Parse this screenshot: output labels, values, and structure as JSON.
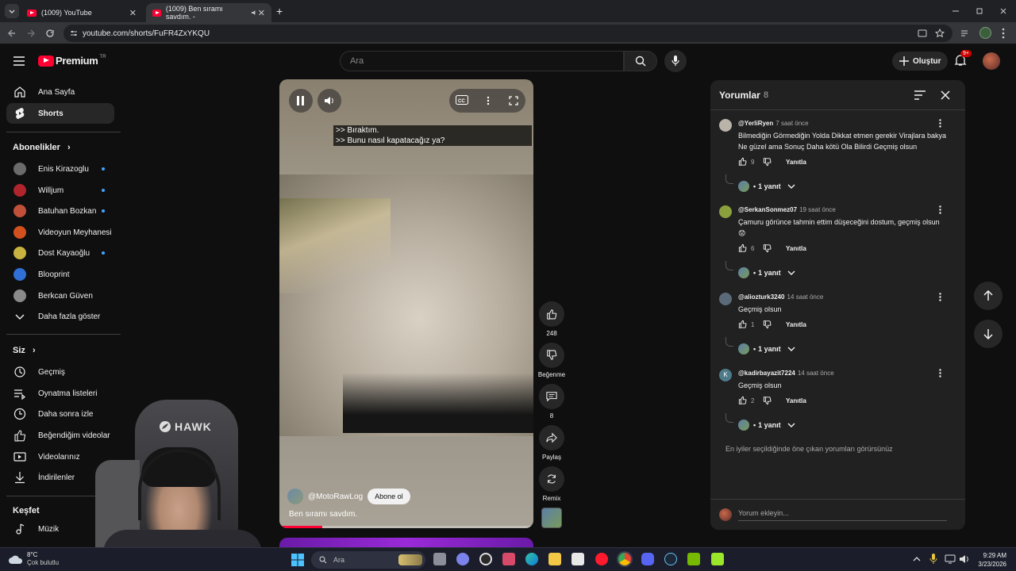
{
  "browser": {
    "tabs": [
      {
        "title": "(1009) YouTube",
        "close": "✕"
      },
      {
        "title": "(1009) Ben sıramı savdım. -",
        "close": "✕"
      }
    ],
    "new_tab": "+",
    "url": "youtube.com/shorts/FuFR4ZxYKQU"
  },
  "header": {
    "logo_text": "Premium",
    "logo_region": "TR",
    "search_placeholder": "Ara",
    "create_label": "Oluştur",
    "notif_count": "9+"
  },
  "sidebar": {
    "main": [
      {
        "label": "Ana Sayfa",
        "icon": "home-icon"
      },
      {
        "label": "Shorts",
        "icon": "shorts-icon",
        "active": true
      }
    ],
    "subs_title": "Abonelikler",
    "subs": [
      {
        "label": "Enis Kirazoglu",
        "color": "#6b6b6b",
        "dot": true
      },
      {
        "label": "Willjum",
        "color": "#b0242c",
        "dot": true
      },
      {
        "label": "Batuhan Bozkan",
        "color": "#c0503a",
        "dot": true
      },
      {
        "label": "Videoyun Meyhanesi",
        "color": "#d2501e",
        "dot": false
      },
      {
        "label": "Dost Kayaoğlu",
        "color": "#c9b340",
        "dot": true
      },
      {
        "label": "Blooprint",
        "color": "#2f6fd6",
        "dot": false
      },
      {
        "label": "Berkcan Güven",
        "color": "#8a8a8a",
        "dot": false
      }
    ],
    "show_more": "Daha fazla göster",
    "you_title": "Siz",
    "you": [
      {
        "label": "Geçmiş",
        "icon": "history-icon"
      },
      {
        "label": "Oynatma listeleri",
        "icon": "playlist-icon"
      },
      {
        "label": "Daha sonra izle",
        "icon": "clock-icon"
      },
      {
        "label": "Beğendiğim videolar",
        "icon": "thumbs-up-icon"
      },
      {
        "label": "Videolarınız",
        "icon": "video-icon"
      },
      {
        "label": "İndirilenler",
        "icon": "download-icon"
      }
    ],
    "explore_title": "Keşfet",
    "explore": [
      {
        "label": "Müzik",
        "icon": "music-icon"
      }
    ]
  },
  "player": {
    "captions": [
      ">> Bıraktım.",
      ">> Bunu nasıl kapatacağız ya?"
    ],
    "channel": "@MotoRawLog",
    "subscribe": "Abone ol",
    "title": "Ben sıramı savdım.",
    "progress": 0.17
  },
  "actions": {
    "likes": "248",
    "dislike": "Beğenme",
    "comments": "8",
    "share": "Paylaş",
    "remix": "Remix"
  },
  "comments": {
    "title": "Yorumlar",
    "count": "8",
    "items": [
      {
        "user": "@YerliRyen",
        "time": "7 saat önce",
        "text": "Bilmediğin Görmediğin Yolda Dikkat etmen gerekir Virajlara bakya Ne güzel ama Sonuç Daha kötü Ola Bilirdi Geçmiş olsun",
        "likes": "9",
        "reply": "Yanıtla",
        "replies": "1 yanıt",
        "color": "#b9b3a9"
      },
      {
        "user": "@SerkanSonmez07",
        "time": "19 saat önce",
        "text": "Çamuru görünce tahmin ettim düşeceğini dostum, geçmiş olsun 😟",
        "likes": "6",
        "reply": "Yanıtla",
        "replies": "1 yanıt",
        "color": "#8aa03c"
      },
      {
        "user": "@aliozturk3240",
        "time": "14 saat önce",
        "text": "Geçmiş olsun",
        "likes": "1",
        "reply": "Yanıtla",
        "replies": "1 yanıt",
        "color": "#5a6a78"
      },
      {
        "user": "@kadirbayazit7224",
        "time": "14 saat önce",
        "text": "Geçmiş olsun",
        "likes": "2",
        "reply": "Yanıtla",
        "replies": "1 yanıt",
        "color": "#4e7a8a",
        "initial": "K"
      }
    ],
    "footer_note": "En iyiler seçildiğinde öne çıkan yorumları görürsünüz",
    "add_placeholder": "Yorum ekleyin..."
  },
  "webcam": {
    "chair_brand": "HAWK"
  },
  "taskbar": {
    "weather_temp": "8°C",
    "weather_desc": "Çok bulutlu",
    "search": "Ara",
    "time": "9:29 AM",
    "date": "3/23/2026"
  },
  "colors": {
    "brand": "#ff0033",
    "bg": "#0f0f0f",
    "panel": "#212121",
    "accent": "#3ea6ff"
  }
}
